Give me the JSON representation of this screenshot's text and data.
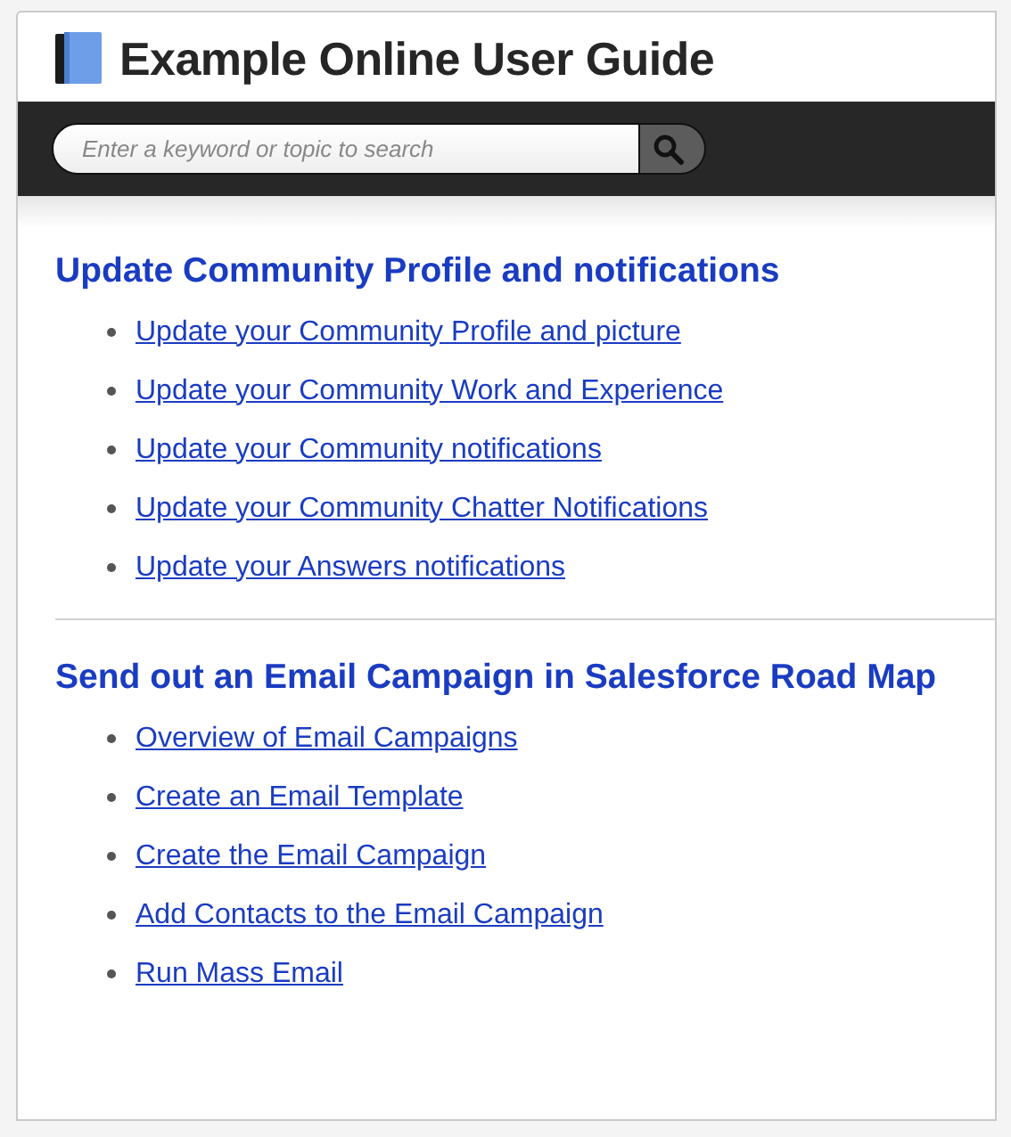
{
  "header": {
    "title": "Example Online User Guide"
  },
  "search": {
    "placeholder": "Enter a keyword or topic to search"
  },
  "sections": [
    {
      "heading": "Update Community Profile and notifications",
      "links": [
        "Update your Community Profile and picture",
        "Update your Community Work and Experience",
        "Update your Community notifications",
        "Update your Community Chatter Notifications",
        "Update your Answers notifications"
      ]
    },
    {
      "heading": "Send out an Email Campaign in Salesforce Road Map",
      "links": [
        "Overview of Email Campaigns",
        "Create an Email Template",
        "Create the Email Campaign",
        "Add Contacts to the Email Campaign",
        "Run Mass Email"
      ]
    }
  ]
}
